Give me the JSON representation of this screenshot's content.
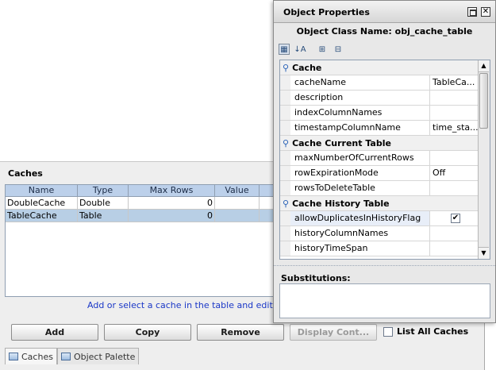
{
  "caches_panel": {
    "title": "Caches",
    "columns": [
      "Name",
      "Type",
      "Max Rows",
      "Value"
    ],
    "rows": [
      {
        "name": "DoubleCache",
        "type": "Double",
        "max_rows": "0",
        "value": ""
      },
      {
        "name": "TableCache",
        "type": "Table",
        "max_rows": "0",
        "value": ""
      }
    ],
    "selected_row_index": 1,
    "hint": "Add or select a cache in the table and edit it in",
    "buttons": {
      "add": "Add",
      "copy": "Copy",
      "remove": "Remove",
      "display": "Display Cont..."
    },
    "list_all_label": "List All Caches",
    "list_all_checked": false
  },
  "tabs": [
    {
      "label": "Caches",
      "icon": "caches-tab-icon",
      "active": true
    },
    {
      "label": "Object Palette",
      "icon": "palette-tab-icon",
      "active": false
    }
  ],
  "properties_window": {
    "title": "Object Properties",
    "class_name_label": "Object Class Name: obj_cache_table",
    "toolbar_icons": [
      "categorized-view-icon",
      "sort-alpha-icon",
      "expand-all-icon",
      "collapse-all-icon"
    ],
    "categories": [
      {
        "name": "Cache",
        "properties": [
          {
            "name": "cacheName",
            "value": "TableCa..."
          },
          {
            "name": "description",
            "value": ""
          },
          {
            "name": "indexColumnNames",
            "value": ""
          },
          {
            "name": "timestampColumnName",
            "value": "time_sta..."
          }
        ]
      },
      {
        "name": "Cache Current Table",
        "properties": [
          {
            "name": "maxNumberOfCurrentRows",
            "value": ""
          },
          {
            "name": "rowExpirationMode",
            "value": "Off"
          },
          {
            "name": "rowsToDeleteTable",
            "value": ""
          }
        ]
      },
      {
        "name": "Cache History Table",
        "properties": [
          {
            "name": "allowDuplicatesInHistoryFlag",
            "value": "✔"
          },
          {
            "name": "historyColumnNames",
            "value": ""
          },
          {
            "name": "historyTimeSpan",
            "value": ""
          }
        ]
      }
    ],
    "substitutions_label": "Substitutions:"
  },
  "colors": {
    "header_blue": "#bcd0ea",
    "selected_row": "#b8cfe5",
    "hint_text": "#1a37c7",
    "category_pin": "#2a63b8"
  }
}
